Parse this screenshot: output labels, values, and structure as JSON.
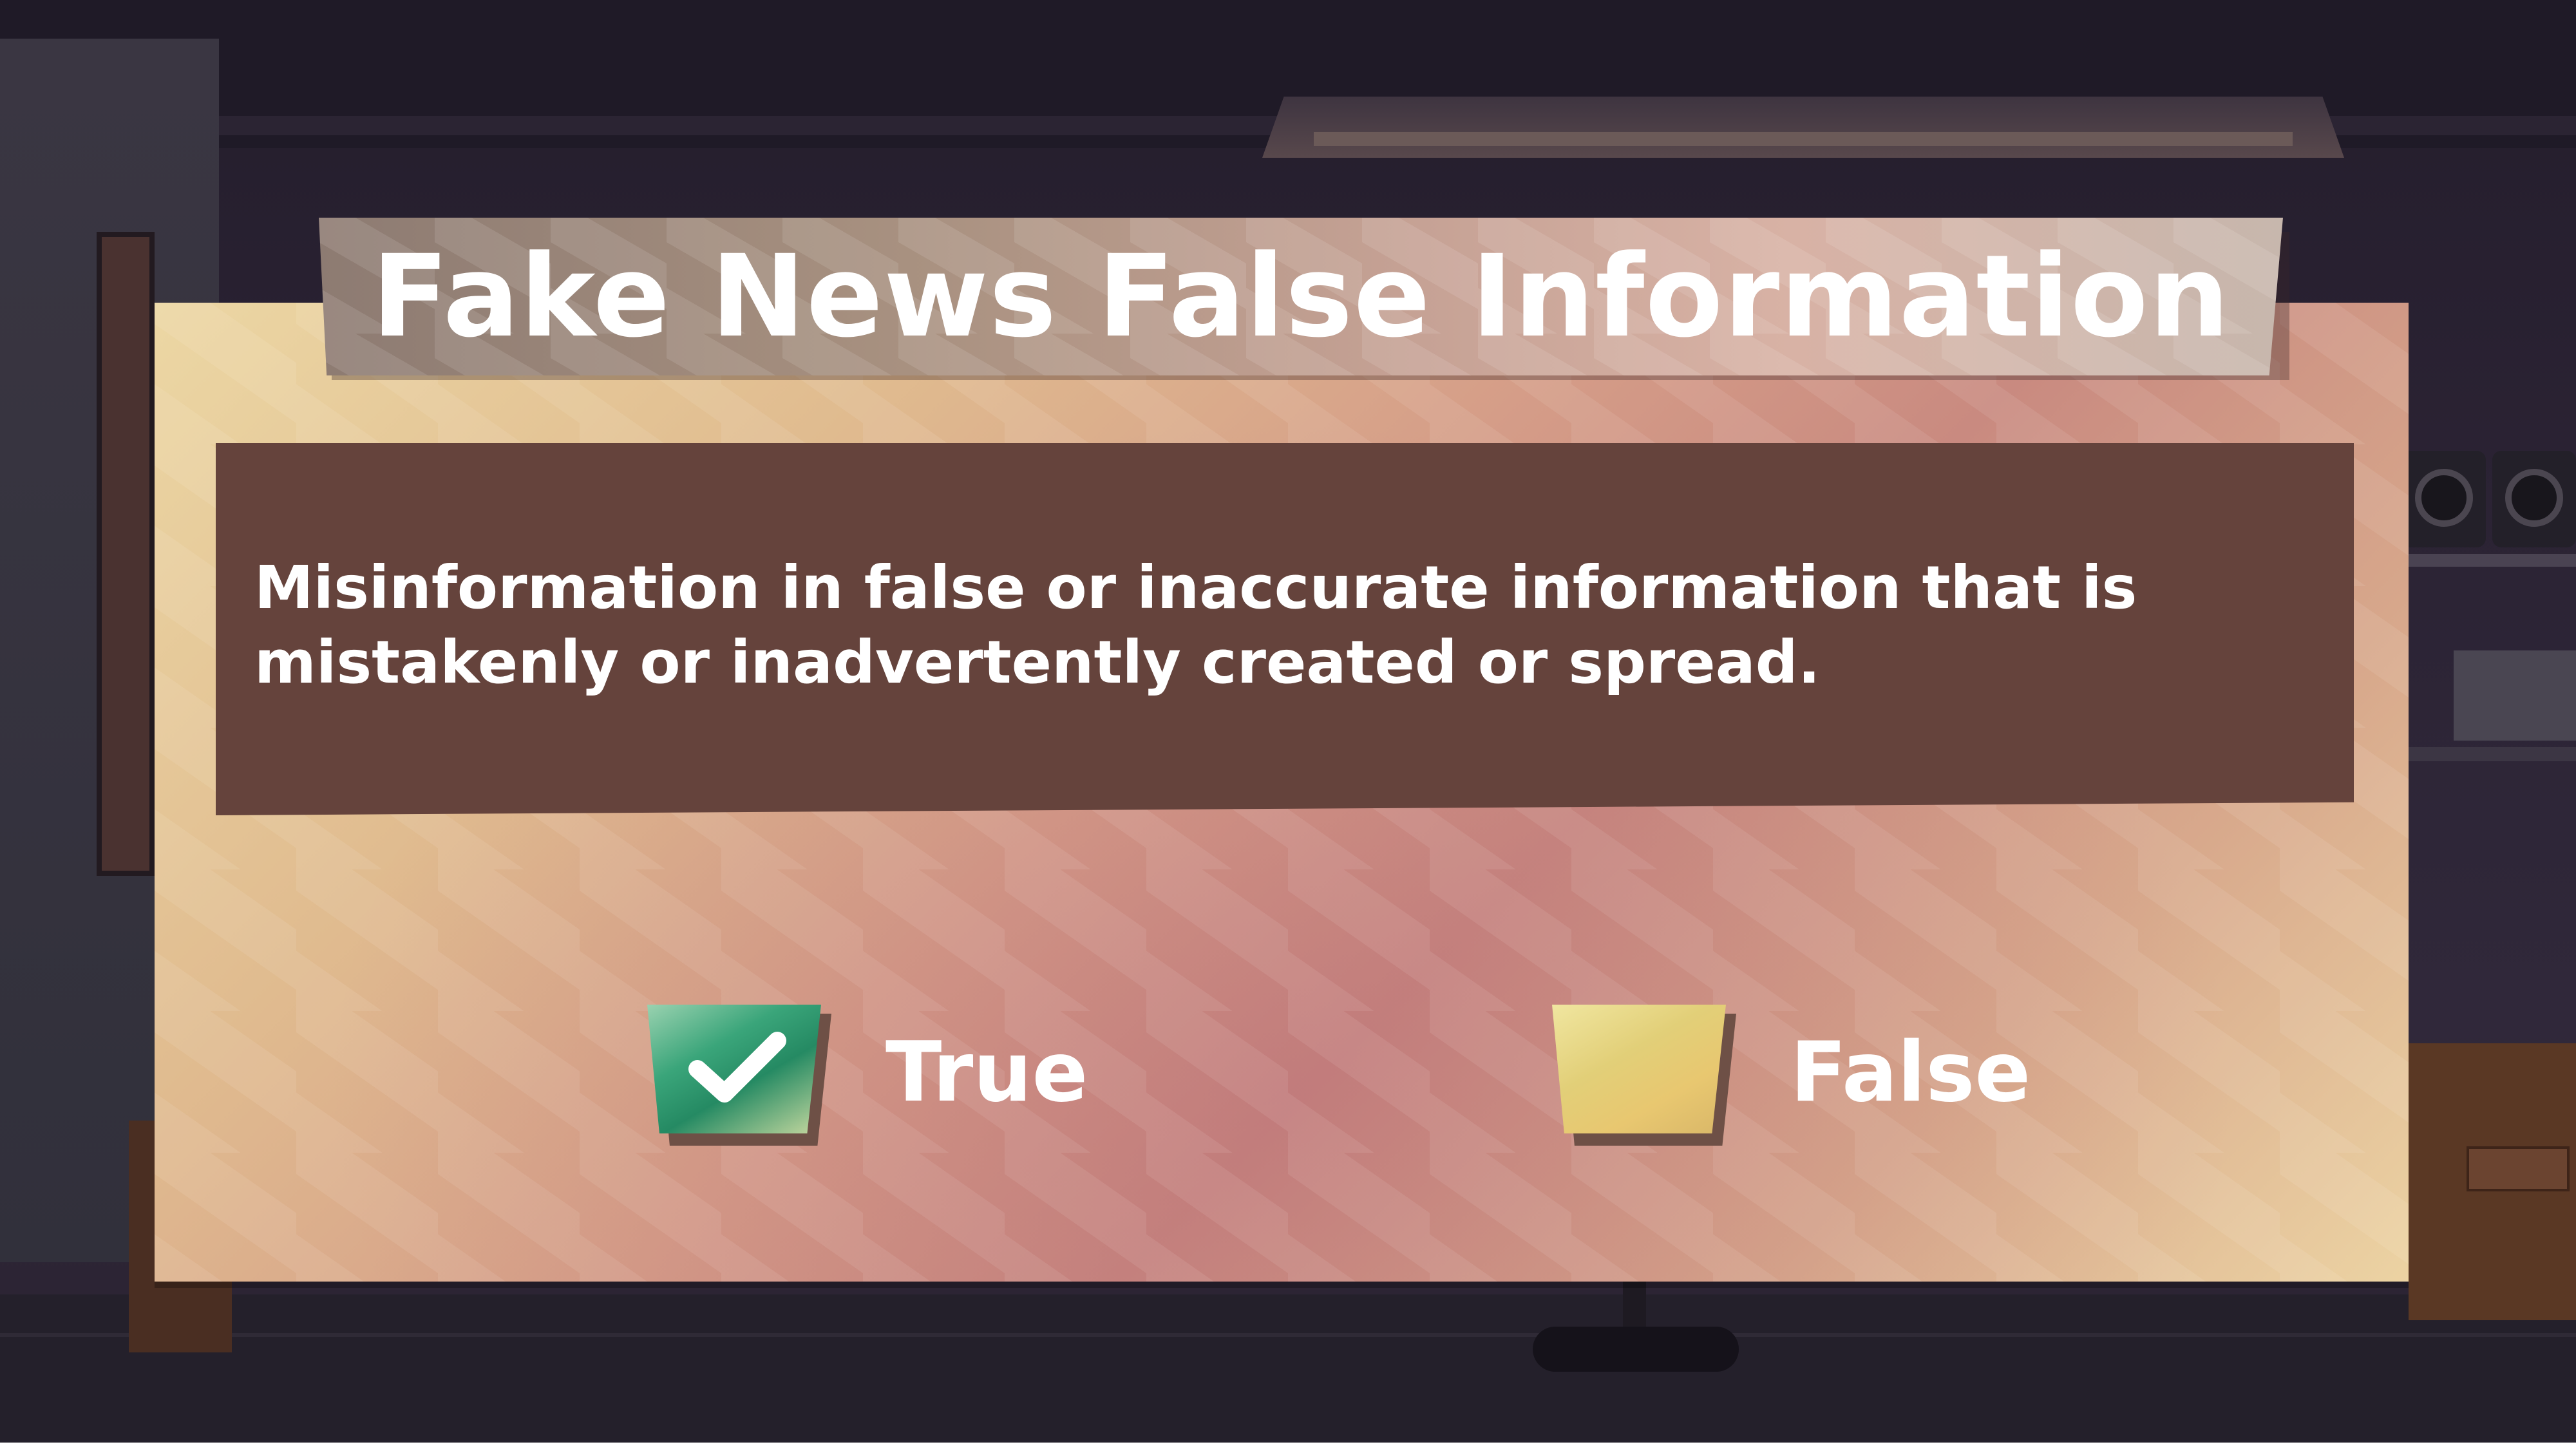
{
  "title": "Fake News False Information",
  "question": {
    "text": "Misinformation in false or inaccurate information that is mistakenly or inadvertently created or spread."
  },
  "options": [
    {
      "label": "True",
      "selected": true,
      "icon": "checkmark-icon",
      "color": "#2f9a70"
    },
    {
      "label": "False",
      "selected": false,
      "icon": "",
      "color": "#e4cc76"
    }
  ],
  "colors": {
    "question_box": "#65433c",
    "panel": "#e0bb8f"
  }
}
